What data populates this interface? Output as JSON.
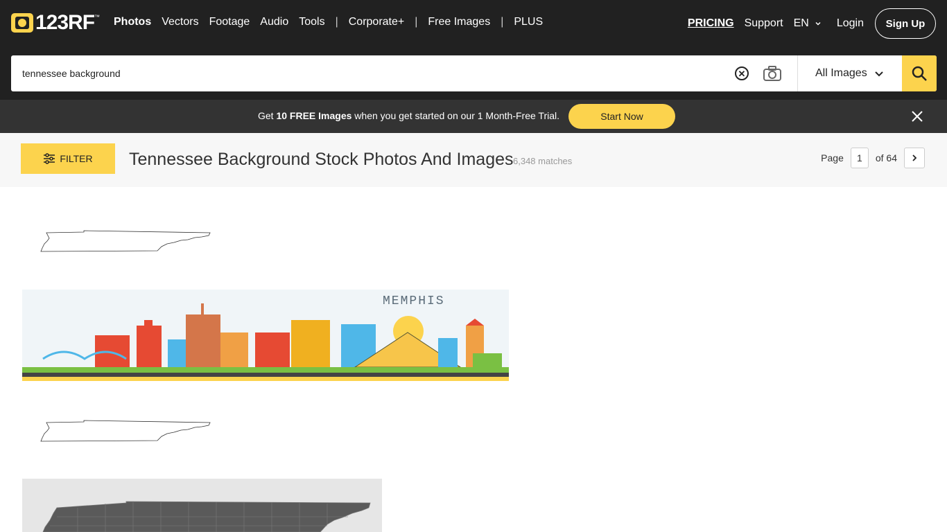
{
  "brand": {
    "logo_text": "123RF",
    "accent": "#fcd34d"
  },
  "nav": {
    "items": [
      "Photos",
      "Vectors",
      "Footage",
      "Audio",
      "Tools",
      "Corporate+",
      "Free Images",
      "PLUS"
    ],
    "separator": "|"
  },
  "right_nav": {
    "pricing": "PRICING",
    "support": "Support",
    "language": "EN",
    "login": "Login",
    "signup": "Sign Up"
  },
  "search": {
    "value": "tennessee background",
    "category": "All Images"
  },
  "promo": {
    "pre": "Get ",
    "bold1": "10 FREE Images",
    "post": " when you get started on our 1 Month-Free Trial.",
    "cta": "Start Now"
  },
  "header": {
    "filter": "FILTER",
    "title": "Tennessee Background Stock Photos And Images",
    "matches": "6,348 matches"
  },
  "pager": {
    "label": "Page",
    "current": "1",
    "of": "of 64"
  },
  "results": [
    {
      "caption": "MEMPHIS"
    }
  ]
}
